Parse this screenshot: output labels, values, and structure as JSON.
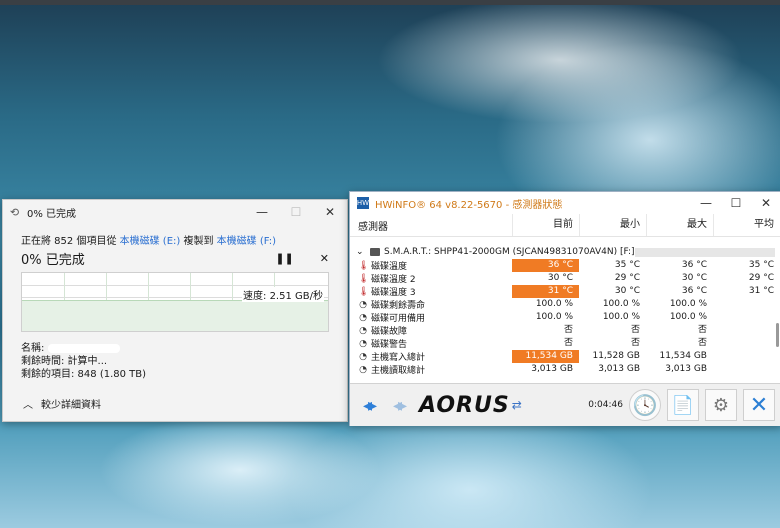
{
  "copy_dialog": {
    "title": "0% 已完成",
    "line_prefix": "正在將 852 個項目從 ",
    "source": "本機磁碟 (E:)",
    "line_mid": " 複製到 ",
    "dest": "本機磁碟 (F:)",
    "percent_text": "0% 已完成",
    "pause_icon": "pause-icon",
    "speed": "速度: 2.51 GB/秒",
    "name_label": "名稱:",
    "time_left": "剩餘時間: 計算中...",
    "items_left": "剩餘的項目: 848 (1.80 TB)",
    "less_details": "較少詳細資料"
  },
  "hwinfo": {
    "title": "HWiNFO® 64 v8.22-5670 - 感測器狀態",
    "headers": {
      "sensor": "感測器",
      "current": "目前",
      "min": "最小",
      "max": "最大",
      "avg": "平均"
    },
    "group": "S.M.A.R.T.: SHPP41-2000GM (SJCAN49831070AV4N) [F:]",
    "rows": [
      {
        "icon": "thermometer-icon",
        "name": "磁碟溫度",
        "current": "36 °C",
        "min": "35 °C",
        "max": "36 °C",
        "avg": "35 °C",
        "hot": true
      },
      {
        "icon": "thermometer-icon",
        "name": "磁碟溫度 2",
        "current": "30 °C",
        "min": "29 °C",
        "max": "30 °C",
        "avg": "29 °C",
        "hot": false
      },
      {
        "icon": "thermometer-icon",
        "name": "磁碟溫度 3",
        "current": "31 °C",
        "min": "30 °C",
        "max": "36 °C",
        "avg": "31 °C",
        "hot": true
      },
      {
        "icon": "gauge-icon",
        "name": "磁碟剩餘壽命",
        "current": "100.0 %",
        "min": "100.0 %",
        "max": "100.0 %",
        "avg": "",
        "hot": false
      },
      {
        "icon": "gauge-icon",
        "name": "磁碟可用備用",
        "current": "100.0 %",
        "min": "100.0 %",
        "max": "100.0 %",
        "avg": "",
        "hot": false
      },
      {
        "icon": "gauge-icon",
        "name": "磁碟故障",
        "current": "否",
        "min": "否",
        "max": "否",
        "avg": "",
        "hot": false
      },
      {
        "icon": "gauge-icon",
        "name": "磁碟警告",
        "current": "否",
        "min": "否",
        "max": "否",
        "avg": "",
        "hot": false
      },
      {
        "icon": "gauge-icon",
        "name": "主機寫入總計",
        "current": "11,534 GB",
        "min": "11,528 GB",
        "max": "11,534 GB",
        "avg": "",
        "hot": true
      },
      {
        "icon": "gauge-icon",
        "name": "主機讀取總計",
        "current": "3,013 GB",
        "min": "3,013 GB",
        "max": "3,013 GB",
        "avg": "",
        "hot": false
      }
    ],
    "brand": "AORUS",
    "timer": "0:04:46"
  }
}
